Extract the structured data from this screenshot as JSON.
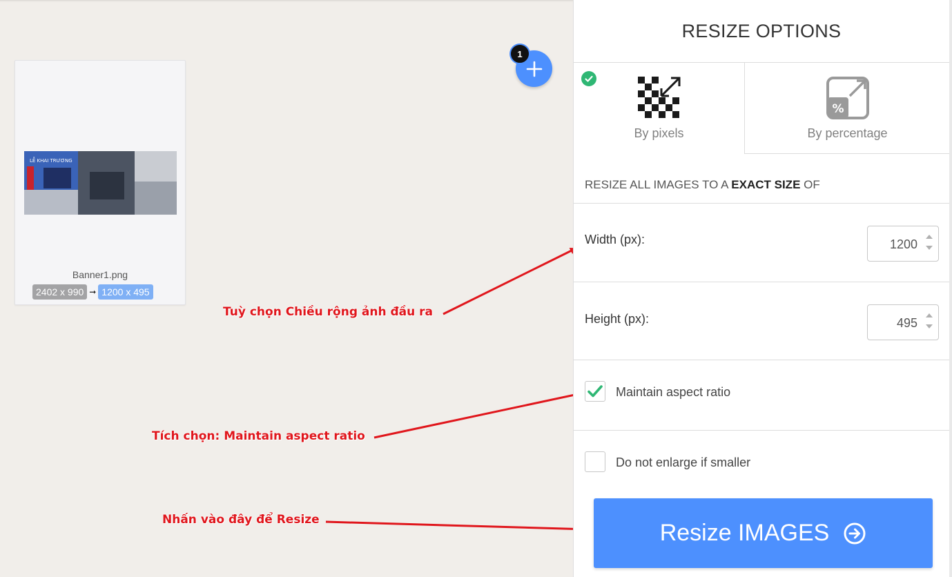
{
  "workspace": {
    "file": {
      "name": "Banner1.png",
      "original_size": "2402 x 990",
      "arrow": "➞",
      "new_size": "1200 x 495",
      "thumbnail_banner_text": "LỄ KHAI TRƯƠNG"
    },
    "add_button": {
      "badge_count": "1",
      "icon": "plus-icon"
    }
  },
  "annotations": {
    "width_note": "Tuỳ chọn Chiều rộng ảnh đầu ra",
    "aspect_note": "Tích chọn: Maintain aspect ratio",
    "resize_note": "Nhấn vào đây để Resize",
    "color": "#e0161c"
  },
  "panel": {
    "title": "RESIZE OPTIONS",
    "tabs": [
      {
        "label": "By pixels",
        "selected": true,
        "icon": "pixels-resize-icon"
      },
      {
        "label": "By percentage",
        "selected": false,
        "icon": "percentage-resize-icon"
      }
    ],
    "section_head": {
      "prefix": "RESIZE ALL IMAGES TO A ",
      "emphasis": "EXACT SIZE",
      "suffix": " OF"
    },
    "width": {
      "label": "Width (px):",
      "value": "1200"
    },
    "height": {
      "label": "Height (px):",
      "value": "495"
    },
    "maintain_aspect": {
      "label": "Maintain aspect ratio",
      "checked": true
    },
    "no_enlarge": {
      "label": "Do not enlarge if smaller",
      "checked": false
    },
    "resize_button": {
      "label": "Resize IMAGES",
      "icon": "arrow-circle-right-icon"
    }
  },
  "colors": {
    "accent": "#4d90fe",
    "success": "#2fb774",
    "background": "#f1eeea"
  }
}
